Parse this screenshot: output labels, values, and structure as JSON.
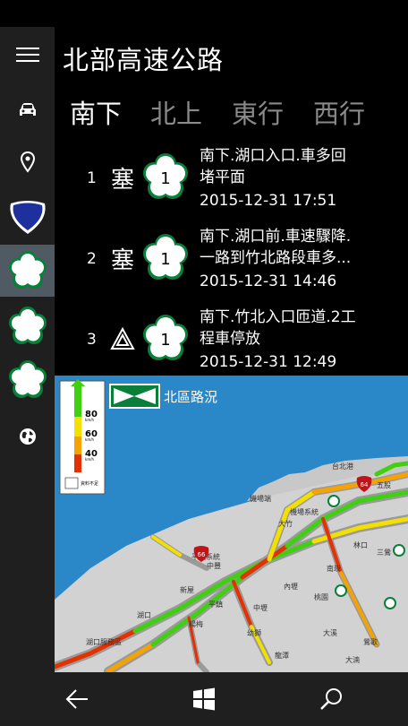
{
  "app": {
    "title": "北部高速公路"
  },
  "sidebar": {
    "items": [
      {
        "icon": "menu-icon"
      },
      {
        "icon": "car-icon"
      },
      {
        "icon": "location-pin-icon"
      },
      {
        "icon": "provincial-highway-shield-icon"
      },
      {
        "icon": "freeway-1-badge-icon"
      },
      {
        "icon": "freeway-3-badge-icon"
      },
      {
        "icon": "freeway-5-badge-icon"
      },
      {
        "icon": "globe-icon"
      }
    ]
  },
  "tabs": [
    {
      "label": "南下",
      "active": true
    },
    {
      "label": "北上",
      "active": false
    },
    {
      "label": "東行",
      "active": false
    },
    {
      "label": "西行",
      "active": false
    }
  ],
  "incidents": [
    {
      "num": "1",
      "status": "塞",
      "badge": "1",
      "line1": "南下.湖口入口.車多回",
      "line2": "堵平面",
      "time": "2015-12-31 17:51"
    },
    {
      "num": "2",
      "status": "塞",
      "badge": "1",
      "line1": "南下.湖口前.車速驟降.",
      "line2": "一路到竹北路段車多...",
      "time": "2015-12-31 14:46"
    },
    {
      "num": "3",
      "status": "⚠",
      "badge": "1",
      "line1": "南下.竹北入口匝道.2工",
      "line2": "程車停放",
      "time": "2015-12-31 12:49"
    }
  ],
  "map": {
    "title": "北區路況",
    "legend": {
      "speed_80": "80",
      "speed_60": "60",
      "speed_40": "40",
      "unit": "km/h",
      "no_data": "資料不足"
    },
    "labels": {
      "taipei_port": "台北港",
      "airport_ic": "機場端",
      "airport_sys": "機場系統",
      "dayuan": "大竹",
      "pingzhen_sys": "平鎮系統",
      "zhongfeng": "中豐",
      "xinwu": "新屋",
      "yangmei": "楊梅",
      "hukou": "湖口",
      "hukou_sa": "湖口服務區",
      "linkou": "林口",
      "nankan": "南崁",
      "dahan": "大溪",
      "sanying": "三鶯",
      "yingge": "鶯歌",
      "wugu": "五股",
      "taoyuan": "桃園",
      "neili": "內壢",
      "zhongli": "中壢",
      "pingzhen": "平鎮",
      "youshi": "幼獅",
      "longtan": "龍潭",
      "dayan": "大溪",
      "lanjiao": "大湳"
    },
    "route_badges": [
      "64",
      "66",
      "2",
      "1",
      "3",
      "1",
      "2",
      "3"
    ]
  },
  "appbar": {
    "back": "back-arrow-icon",
    "home": "windows-logo-icon",
    "search": "search-icon"
  },
  "colors": {
    "accent_freeway": "#0a7f3a",
    "provincial_shield": "#1e2f9e",
    "active_rail": "#505a62",
    "sea": "#2a88c9",
    "land": "#d2d2d2"
  }
}
